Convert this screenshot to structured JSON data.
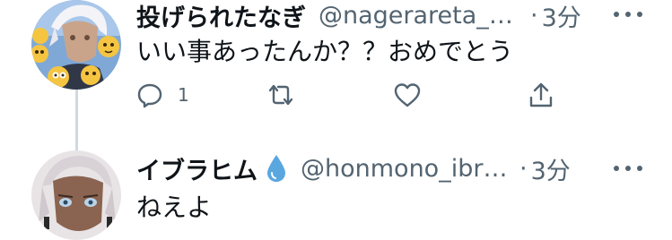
{
  "tweets": [
    {
      "display_name": "投げられたなぎ",
      "handle": "@nagerareta_n...",
      "separator": "·",
      "time": "3分",
      "text": "いい事あったんか？？おめでとう",
      "reply_count": "1",
      "avatar_icon": "anime-avatar-with-emoji-icon"
    },
    {
      "display_name": "イブラヒム",
      "handle": "@honmono_ibra...",
      "separator": "·",
      "time": "3分",
      "text": "ねえよ",
      "avatar_icon": "anime-avatar-icon",
      "name_badge_icon": "water-drop-icon"
    }
  ],
  "colors": {
    "text_primary": "#0f1419",
    "text_secondary": "#536471",
    "thread_line": "#cfd9de",
    "water_drop": "#5aa7e0"
  }
}
